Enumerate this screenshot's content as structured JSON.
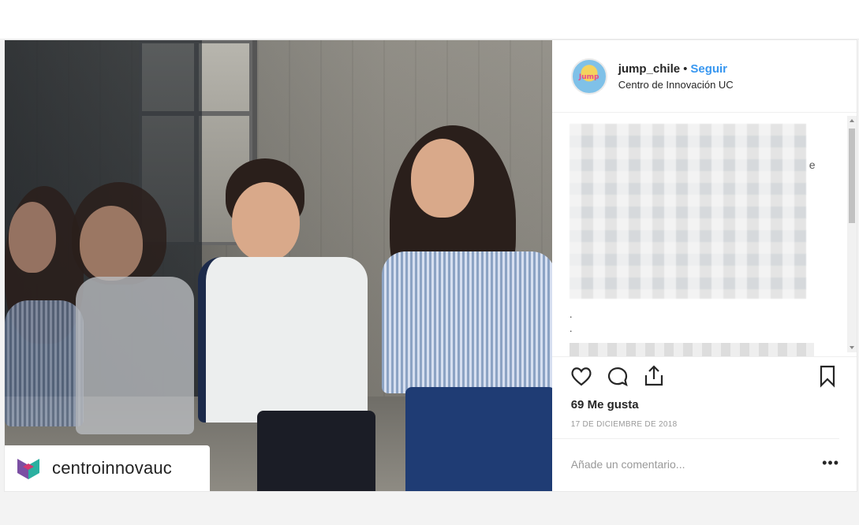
{
  "post": {
    "brand_tag": {
      "name": "centroinnovauc",
      "logo": "centroinnova-logo"
    },
    "header": {
      "username": "jump_chile",
      "separator": "•",
      "follow_label": "Seguir",
      "location": "Centro de Innovación UC",
      "avatar_text": "Jump"
    },
    "caption": {
      "stray_char": "e",
      "dots": [
        ".",
        "."
      ]
    },
    "actions": {
      "like_icon": "heart-icon",
      "comment_icon": "comment-icon",
      "share_icon": "share-icon",
      "save_icon": "bookmark-icon"
    },
    "likes_text": "69 Me gusta",
    "date_text": "17 DE DICIEMBRE DE 2018",
    "comment": {
      "placeholder": "Añade un comentario...",
      "more_label": "•••"
    },
    "colors": {
      "follow": "#3897f0",
      "text": "#262626",
      "muted": "#999999"
    }
  }
}
